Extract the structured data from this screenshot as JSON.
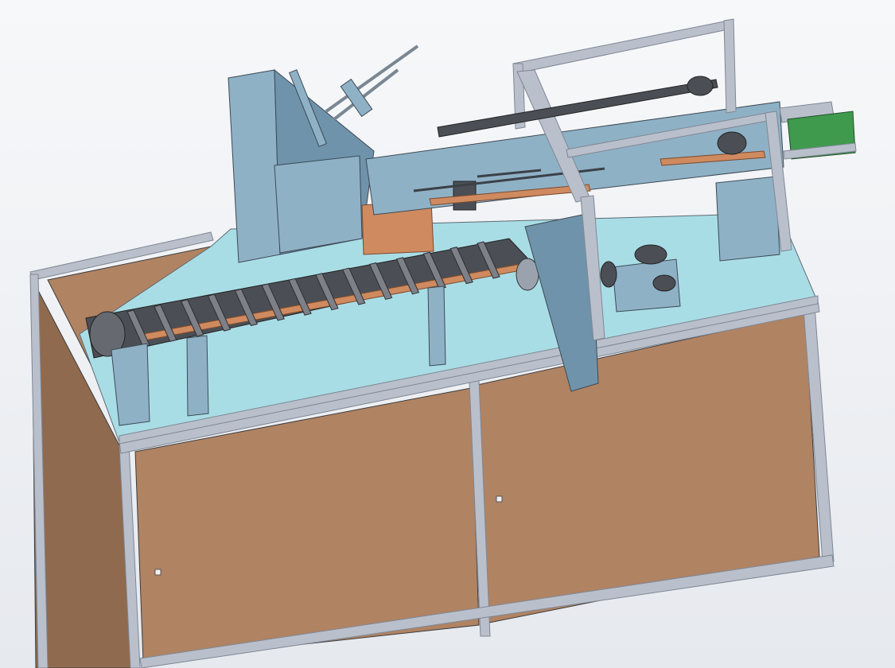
{
  "viewport": {
    "background_top": "#f7f8fa",
    "background_bottom": "#e6e9ee"
  },
  "model": {
    "components": [
      "cabinet-base",
      "aluminum-frame",
      "box-magazine",
      "carton-feed-arm",
      "flight-conveyor",
      "overhead-gantry",
      "chain-drive",
      "gearbox-motor",
      "outfeed-conveyor",
      "guide-plate"
    ],
    "colors": {
      "panel_wood": "#b08363",
      "panel_wood_dark": "#8f6a4e",
      "frame_aluminum": "#b9c0cb",
      "frame_aluminum_dark": "#7f8794",
      "table_top": "#a9dde6",
      "machine_blue": "#8fb1c6",
      "machine_blue_dark": "#6f93aa",
      "belt_dark": "#4b4f55",
      "copper_part": "#cf8a5f",
      "outfeed_green": "#3f9a4e"
    }
  }
}
